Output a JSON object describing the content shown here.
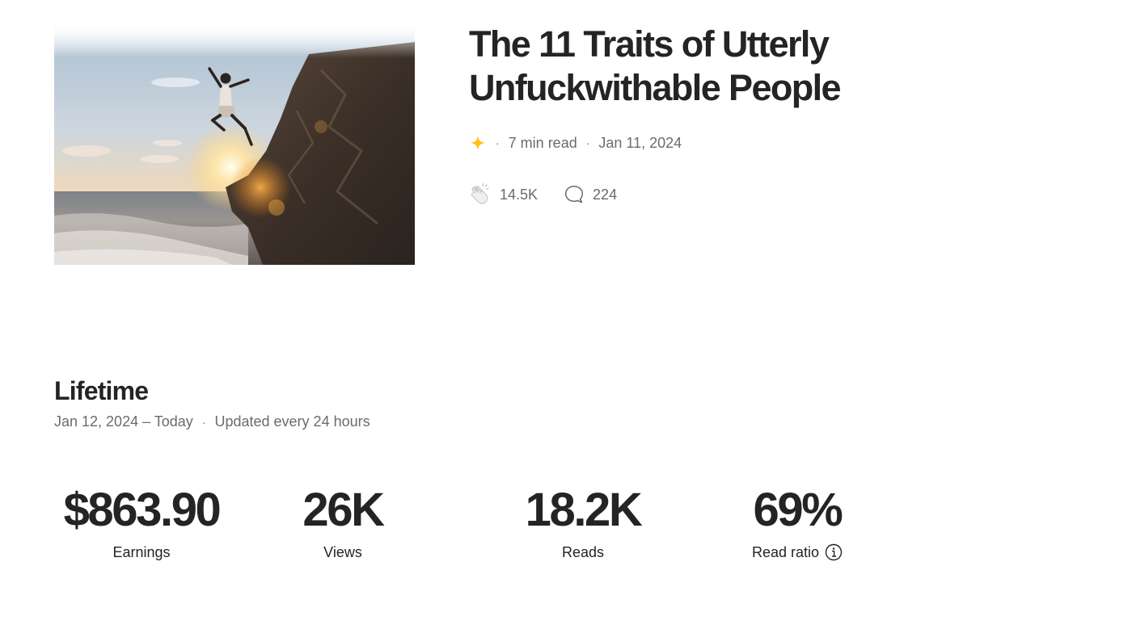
{
  "story": {
    "title": "The 11 Traits of Utterly Unfuckwithable People",
    "member_icon": "sparkle-icon",
    "read_time": "7 min read",
    "published": "Jan 11, 2024",
    "claps": "14.5K",
    "responses": "224",
    "colors": {
      "sparkle": "#FFC017",
      "text_muted": "#6B6B6B",
      "text_main": "#242424"
    }
  },
  "lifetime": {
    "title": "Lifetime",
    "range": "Jan 12, 2024 – Today",
    "update_note": "Updated every 24 hours",
    "metrics": [
      {
        "value": "$863.90",
        "label": "Earnings"
      },
      {
        "value": "26K",
        "label": "Views"
      },
      {
        "value": "18.2K",
        "label": "Reads"
      },
      {
        "value": "69%",
        "label": "Read ratio",
        "icon": "info-icon"
      }
    ]
  }
}
